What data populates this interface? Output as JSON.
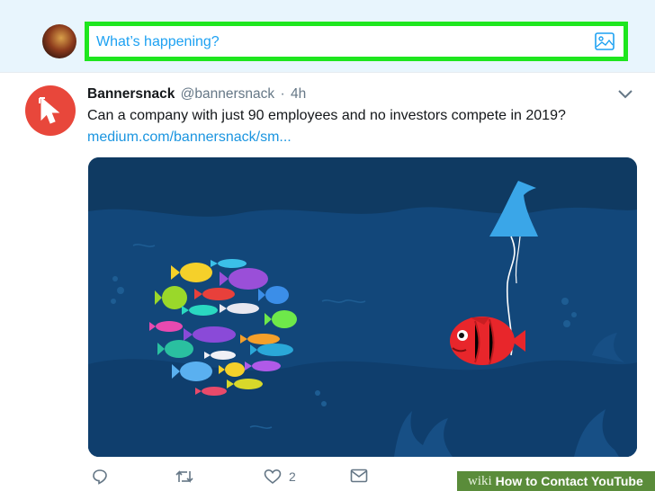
{
  "compose": {
    "placeholder": "What’s happening?",
    "media_icon": "image-icon"
  },
  "tweet": {
    "display_name": "Bannersnack",
    "handle": "@bannersnack",
    "separator": "·",
    "time": "4h",
    "text": "Can a company with just 90 employees and no investors compete in 2019?",
    "link": "medium.com/bannersnack/sm...",
    "avatar_icon": "cursor-icon",
    "menu_icon": "chevron-down-icon",
    "card_image": "illustration of a school of colorful fish and a red fish wearing a shark fin"
  },
  "actions": {
    "reply_icon": "reply-icon",
    "retweet_icon": "retweet-icon",
    "like_icon": "heart-icon",
    "like_count": "2",
    "dm_icon": "envelope-icon"
  },
  "watermark": {
    "logo": "wiki",
    "title": "How to Contact YouTube"
  },
  "colors": {
    "accent": "#1da1f2",
    "highlight": "#1ee61e",
    "avatar_bg": "#e8473b",
    "card_bg": "#0f3a62"
  }
}
